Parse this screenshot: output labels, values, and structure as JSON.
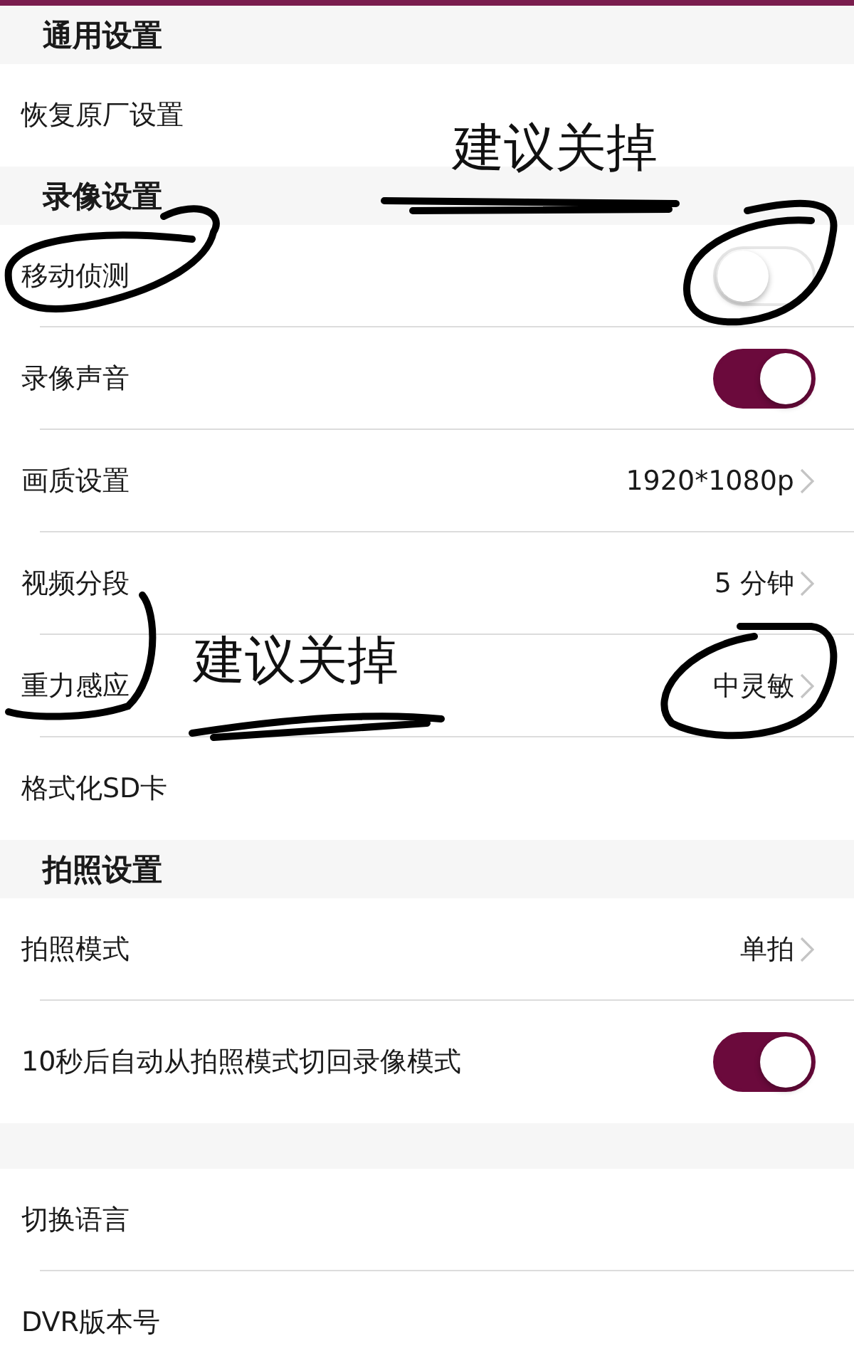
{
  "sections": [
    {
      "title": "通用设置",
      "rows": [
        {
          "kind": "plain",
          "label": "恢复原厂设置"
        }
      ]
    },
    {
      "title": "录像设置",
      "rows": [
        {
          "kind": "toggle",
          "label": "移动侦测",
          "on": false
        },
        {
          "kind": "toggle",
          "label": "录像声音",
          "on": true
        },
        {
          "kind": "value",
          "label": "画质设置",
          "value": "1920*1080p"
        },
        {
          "kind": "value",
          "label": "视频分段",
          "value": "5 分钟"
        },
        {
          "kind": "value",
          "label": "重力感应",
          "value": "中灵敏"
        },
        {
          "kind": "plain",
          "label": "格式化SD卡"
        }
      ]
    },
    {
      "title": "拍照设置",
      "rows": [
        {
          "kind": "value",
          "label": "拍照模式",
          "value": "单拍"
        },
        {
          "kind": "toggle",
          "label": "10秒后自动从拍照模式切回录像模式",
          "on": true
        }
      ]
    },
    {
      "rows": [
        {
          "kind": "plain",
          "label": "切换语言"
        },
        {
          "kind": "plain",
          "label": "DVR版本号"
        }
      ]
    }
  ],
  "annotations": [
    {
      "text": "建议关掉"
    },
    {
      "text": "建议关掉"
    }
  ]
}
